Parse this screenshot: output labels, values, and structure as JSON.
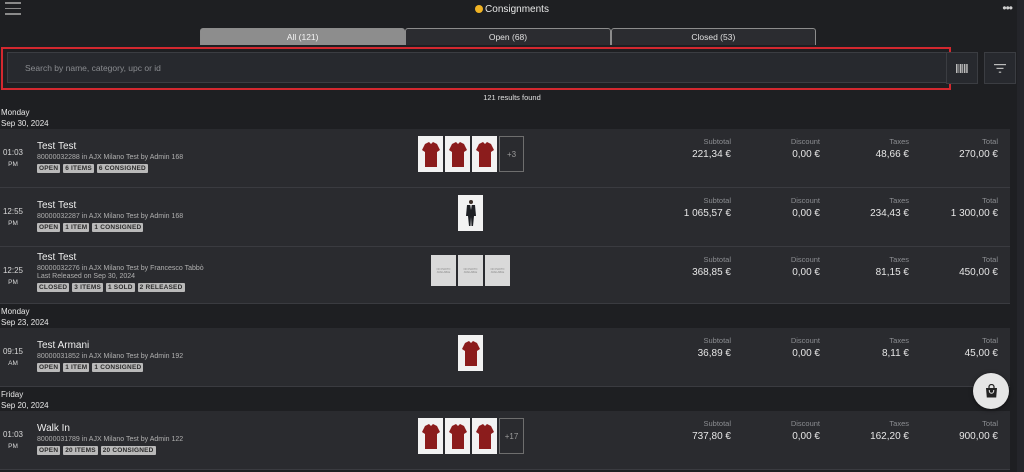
{
  "header": {
    "title": "Consignments"
  },
  "tabs": [
    {
      "label": "All (121)"
    },
    {
      "label": "Open (68)"
    },
    {
      "label": "Closed (53)"
    }
  ],
  "search": {
    "placeholder": "Search by name, category, upc or id",
    "value": ""
  },
  "results_text": "121 results found",
  "columns": {
    "subtotal": "Subtotal",
    "discount": "Discount",
    "taxes": "Taxes",
    "total": "Total"
  },
  "groups": [
    {
      "day": "Monday",
      "date": "Sep 30, 2024"
    },
    {
      "day": "Monday",
      "date": "Sep 23, 2024"
    },
    {
      "day": "Friday",
      "date": "Sep 20, 2024"
    }
  ],
  "rows": [
    {
      "time": "01:03",
      "ampm": "PM",
      "customer": "Test Test",
      "line1": "80000032288 in AJX Milano Test by Admin 168",
      "line2": "",
      "badges": [
        "OPEN",
        "6 ITEMS",
        "6 CONSIGNED"
      ],
      "more_images": "+3",
      "subtotal": "221,34 €",
      "discount": "0,00 €",
      "taxes": "48,66 €",
      "total": "270,00 €"
    },
    {
      "time": "12:55",
      "ampm": "PM",
      "customer": "Test Test",
      "line1": "80000032287 in AJX Milano Test by Admin 168",
      "line2": "",
      "badges": [
        "OPEN",
        "1 ITEM",
        "1 CONSIGNED"
      ],
      "more_images": "",
      "subtotal": "1 065,57 €",
      "discount": "0,00 €",
      "taxes": "234,43 €",
      "total": "1 300,00 €"
    },
    {
      "time": "12:25",
      "ampm": "PM",
      "customer": "Test Test",
      "line1": "80000032276 in AJX Milano Test by Francesco Tabbò",
      "line2": "Last Released on Sep 30, 2024",
      "badges": [
        "CLOSED",
        "3 ITEMS",
        "1 SOLD",
        "2 RELEASED"
      ],
      "more_images": "",
      "no_photo_text": "NO PHOTO AVAILABLE",
      "subtotal": "368,85 €",
      "discount": "0,00 €",
      "taxes": "81,15 €",
      "total": "450,00 €"
    },
    {
      "time": "09:15",
      "ampm": "AM",
      "customer": "Test Armani",
      "line1": "80000031852 in AJX Milano Test by Admin 192",
      "line2": "",
      "badges": [
        "OPEN",
        "1 ITEM",
        "1 CONSIGNED"
      ],
      "more_images": "",
      "subtotal": "36,89 €",
      "discount": "0,00 €",
      "taxes": "8,11 €",
      "total": "45,00 €"
    },
    {
      "time": "01:03",
      "ampm": "PM",
      "customer": "Walk In",
      "line1": "80000031789 in AJX Milano Test by Admin 122",
      "line2": "",
      "badges": [
        "OPEN",
        "20 ITEMS",
        "20 CONSIGNED"
      ],
      "more_images": "+17",
      "subtotal": "737,80 €",
      "discount": "0,00 €",
      "taxes": "162,20 €",
      "total": "900,00 €"
    }
  ],
  "icons": {
    "menu": "hamburger-icon",
    "more": "more-horizontal-icon",
    "barcode": "barcode-icon",
    "filter": "filter-icon",
    "bag": "shopping-bag-icon",
    "title_emoji": "emoji-icon"
  },
  "colors": {
    "accent_border": "#d3282f",
    "shirt": "#8b1c1c",
    "background": "#1e1f22"
  }
}
